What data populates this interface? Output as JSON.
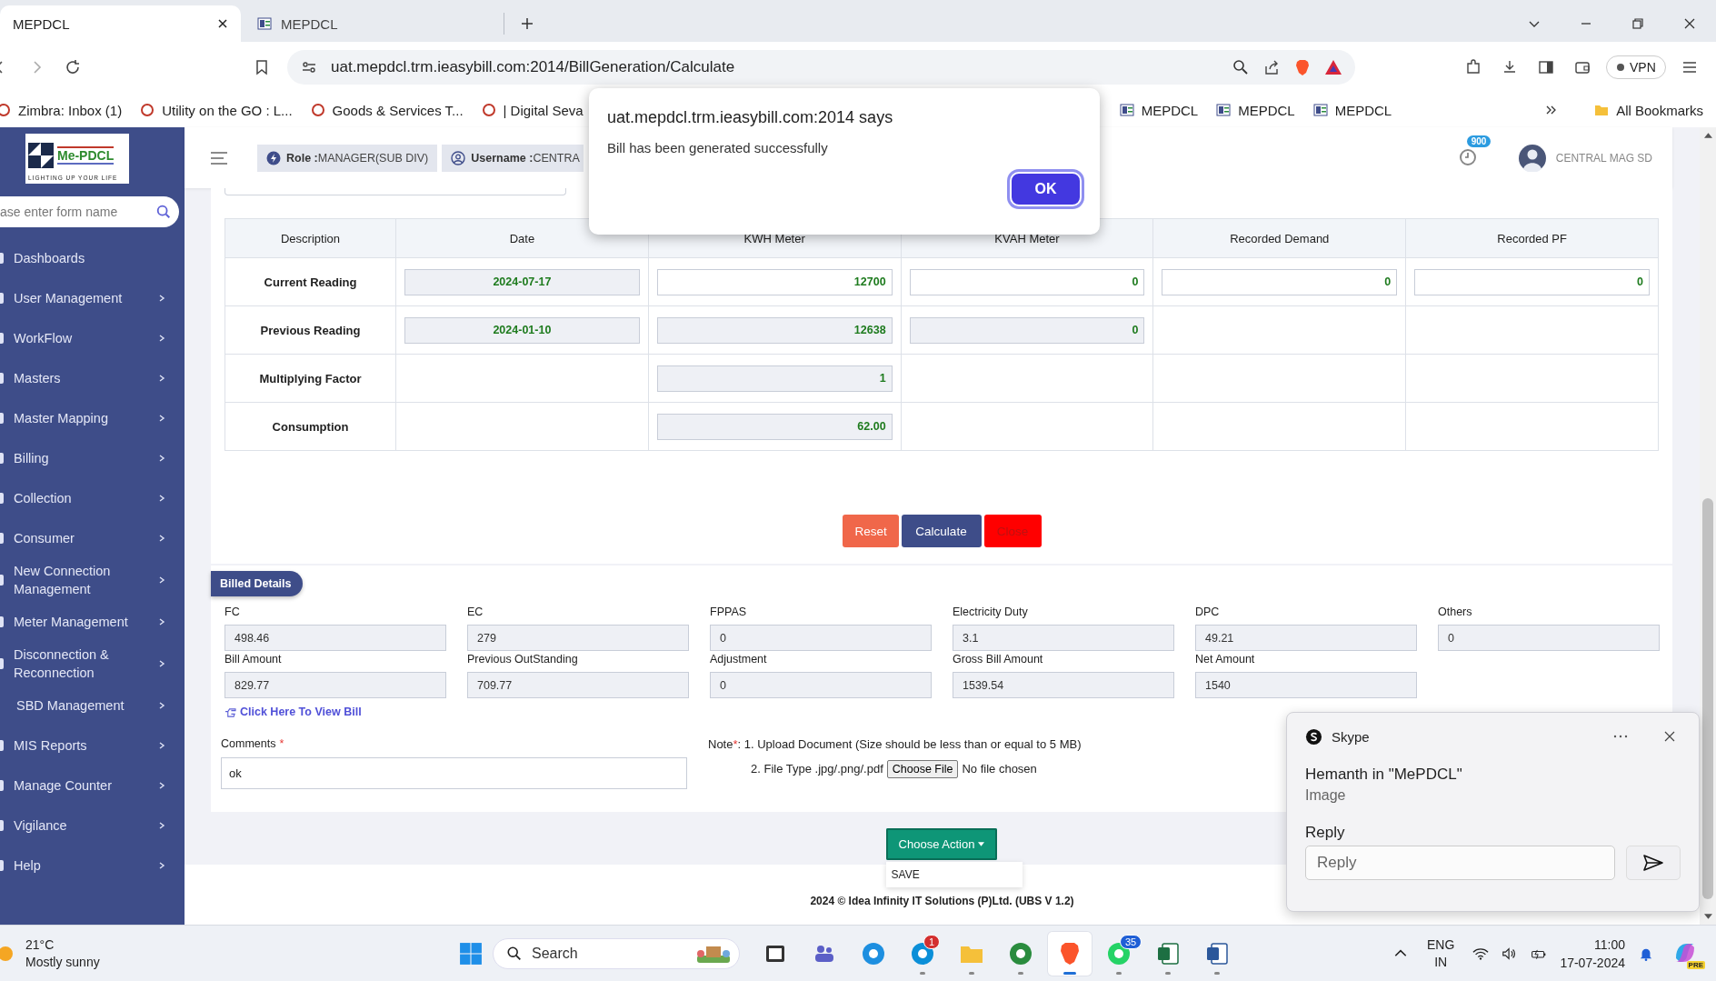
{
  "browser": {
    "tabs": [
      {
        "title": "MEPDCL",
        "selected": true
      },
      {
        "title": "MEPDCL",
        "selected": false
      }
    ],
    "url": "uat.mepdcl.trm.ieasybill.com:2014/BillGeneration/Calculate",
    "vpn": "VPN",
    "bookmarks": [
      {
        "label": "Zimbra: Inbox (1)"
      },
      {
        "label": "Utility on the GO : L..."
      },
      {
        "label": "Goods & Services T..."
      },
      {
        "label": "| Digital Seva"
      }
    ],
    "bookmarks_past_dialog": [
      {
        "label": "MEPDCL"
      },
      {
        "label": "MEPDCL"
      },
      {
        "label": "MEPDCL"
      }
    ],
    "all_bookmarks": "All Bookmarks"
  },
  "sidebar": {
    "logo": {
      "name": "Me-PDCL",
      "tagline": "LIGHTING UP YOUR LIFE"
    },
    "search": {
      "placeholder": "ase enter form name"
    },
    "items": [
      {
        "label": "Dashboards",
        "expandable": false,
        "icon": true
      },
      {
        "label": "User Management",
        "expandable": true,
        "icon": true
      },
      {
        "label": "WorkFlow",
        "expandable": true,
        "icon": true
      },
      {
        "label": "Masters",
        "expandable": true,
        "icon": true
      },
      {
        "label": "Master Mapping",
        "expandable": true,
        "icon": true
      },
      {
        "label": "Billing",
        "expandable": true,
        "icon": true
      },
      {
        "label": "Collection",
        "expandable": true,
        "icon": true
      },
      {
        "label": "Consumer",
        "expandable": true,
        "icon": true
      },
      {
        "label": "New Connection Management",
        "expandable": true,
        "icon": true
      },
      {
        "label": "Meter Management",
        "expandable": true,
        "icon": true
      },
      {
        "label": "Disconnection & Reconnection",
        "expandable": true,
        "icon": true
      },
      {
        "label": "SBD Management",
        "expandable": true,
        "icon": false
      },
      {
        "label": "MIS Reports",
        "expandable": true,
        "icon": true
      },
      {
        "label": "Manage Counter",
        "expandable": true,
        "icon": true
      },
      {
        "label": "Vigilance",
        "expandable": true,
        "icon": true
      },
      {
        "label": "Help",
        "expandable": true,
        "icon": true
      }
    ]
  },
  "header": {
    "role_label": "Role :",
    "role": "MANAGER(SUB DIV)",
    "username_label": "Username :",
    "username": "CENTRA",
    "notifications": "900",
    "user": "CENTRAL MAG SD"
  },
  "readings": {
    "columns": [
      "Description",
      "Date",
      "KWH Meter",
      "KVAH Meter",
      "Recorded Demand",
      "Recorded PF"
    ],
    "rows": [
      {
        "cells": [
          {
            "kind": "label",
            "value": "Current Reading"
          },
          {
            "kind": "readonly",
            "value": "2024-07-17"
          },
          {
            "kind": "editable",
            "value": "12700"
          },
          {
            "kind": "editable",
            "value": "0"
          },
          {
            "kind": "editable",
            "value": "0"
          },
          {
            "kind": "editable",
            "value": "0"
          }
        ]
      },
      {
        "cells": [
          {
            "kind": "label",
            "value": "Previous Reading"
          },
          {
            "kind": "readonly",
            "value": "2024-01-10"
          },
          {
            "kind": "readonly",
            "value": "12638"
          },
          {
            "kind": "readonly",
            "value": "0"
          },
          {
            "kind": "empty"
          },
          {
            "kind": "empty"
          }
        ]
      },
      {
        "cells": [
          {
            "kind": "label",
            "value": "Multiplying Factor"
          },
          {
            "kind": "empty"
          },
          {
            "kind": "readonly",
            "value": "1"
          },
          {
            "kind": "empty"
          },
          {
            "kind": "empty"
          },
          {
            "kind": "empty"
          }
        ]
      },
      {
        "cells": [
          {
            "kind": "label",
            "value": "Consumption"
          },
          {
            "kind": "empty"
          },
          {
            "kind": "readonly",
            "value": "62.00"
          },
          {
            "kind": "empty"
          },
          {
            "kind": "empty"
          },
          {
            "kind": "empty"
          }
        ]
      }
    ],
    "buttons": [
      {
        "kind": "reset",
        "label": "Reset"
      },
      {
        "kind": "calculate",
        "label": "Calculate"
      },
      {
        "kind": "close",
        "label": "Close"
      }
    ]
  },
  "billed_details": {
    "title": "Billed Details",
    "fields": [
      {
        "label": "FC",
        "value": "498.46"
      },
      {
        "label": "EC",
        "value": "279"
      },
      {
        "label": "FPPAS",
        "value": "0"
      },
      {
        "label": "Electricity Duty",
        "value": "3.1"
      },
      {
        "label": "DPC",
        "value": "49.21"
      },
      {
        "label": "Others",
        "value": "0"
      },
      {
        "label": "Bill Amount",
        "value": "829.77"
      },
      {
        "label": "Previous OutStanding",
        "value": "709.77"
      },
      {
        "label": "Adjustment",
        "value": "0"
      },
      {
        "label": "Gross Bill Amount",
        "value": "1539.54"
      },
      {
        "label": "Net Amount",
        "value": "1540"
      }
    ],
    "view_bill_link": "Click Here To View Bill",
    "comments": {
      "label": "Comments",
      "required_mark": "*",
      "value": "ok"
    },
    "note": {
      "label": "Note",
      "required_mark": "*",
      "text": ": 1. Upload Document (Size should be less than or equal to 5 MB)"
    },
    "file": {
      "hint": "2. File Type .jpg/.png/.pdf",
      "button": "Choose File",
      "status": "No file chosen"
    }
  },
  "action": {
    "label": "Choose Action",
    "expanded": true,
    "options": [
      "SAVE"
    ]
  },
  "footer": "2024 © Idea Infinity IT Solutions (P)Ltd. (UBS V 1.2)",
  "dialog": {
    "title": "uat.mepdcl.trm.ieasybill.com:2014 says",
    "message": "Bill has been generated successfully",
    "button": "OK"
  },
  "toast": {
    "app": "Skype",
    "title": "Hemanth in \"MePDCL\"",
    "body": "Image",
    "reply_label": "Reply",
    "reply_placeholder": "Reply"
  },
  "taskbar": {
    "temperature": "21°C",
    "condition": "Mostly sunny",
    "search": "Search",
    "apps": [
      {
        "kind": "terminal",
        "running": false,
        "selected": false
      },
      {
        "kind": "people",
        "running": false,
        "selected": false
      },
      {
        "kind": "wave",
        "running": false,
        "selected": false
      },
      {
        "kind": "messenger",
        "running": true,
        "selected": false,
        "badge": "1"
      },
      {
        "kind": "folder",
        "running": true,
        "selected": false
      },
      {
        "kind": "globe",
        "running": true,
        "selected": false
      },
      {
        "kind": "lion",
        "running": true,
        "selected": true
      },
      {
        "kind": "phone",
        "running": true,
        "selected": false,
        "badge": "35"
      },
      {
        "kind": "sheet",
        "running": true,
        "selected": false
      },
      {
        "kind": "document",
        "running": true,
        "selected": false
      }
    ],
    "language": "ENG",
    "region": "IN",
    "time": "11:00",
    "date": "17-07-2024",
    "assistant_badge": "PRE"
  }
}
